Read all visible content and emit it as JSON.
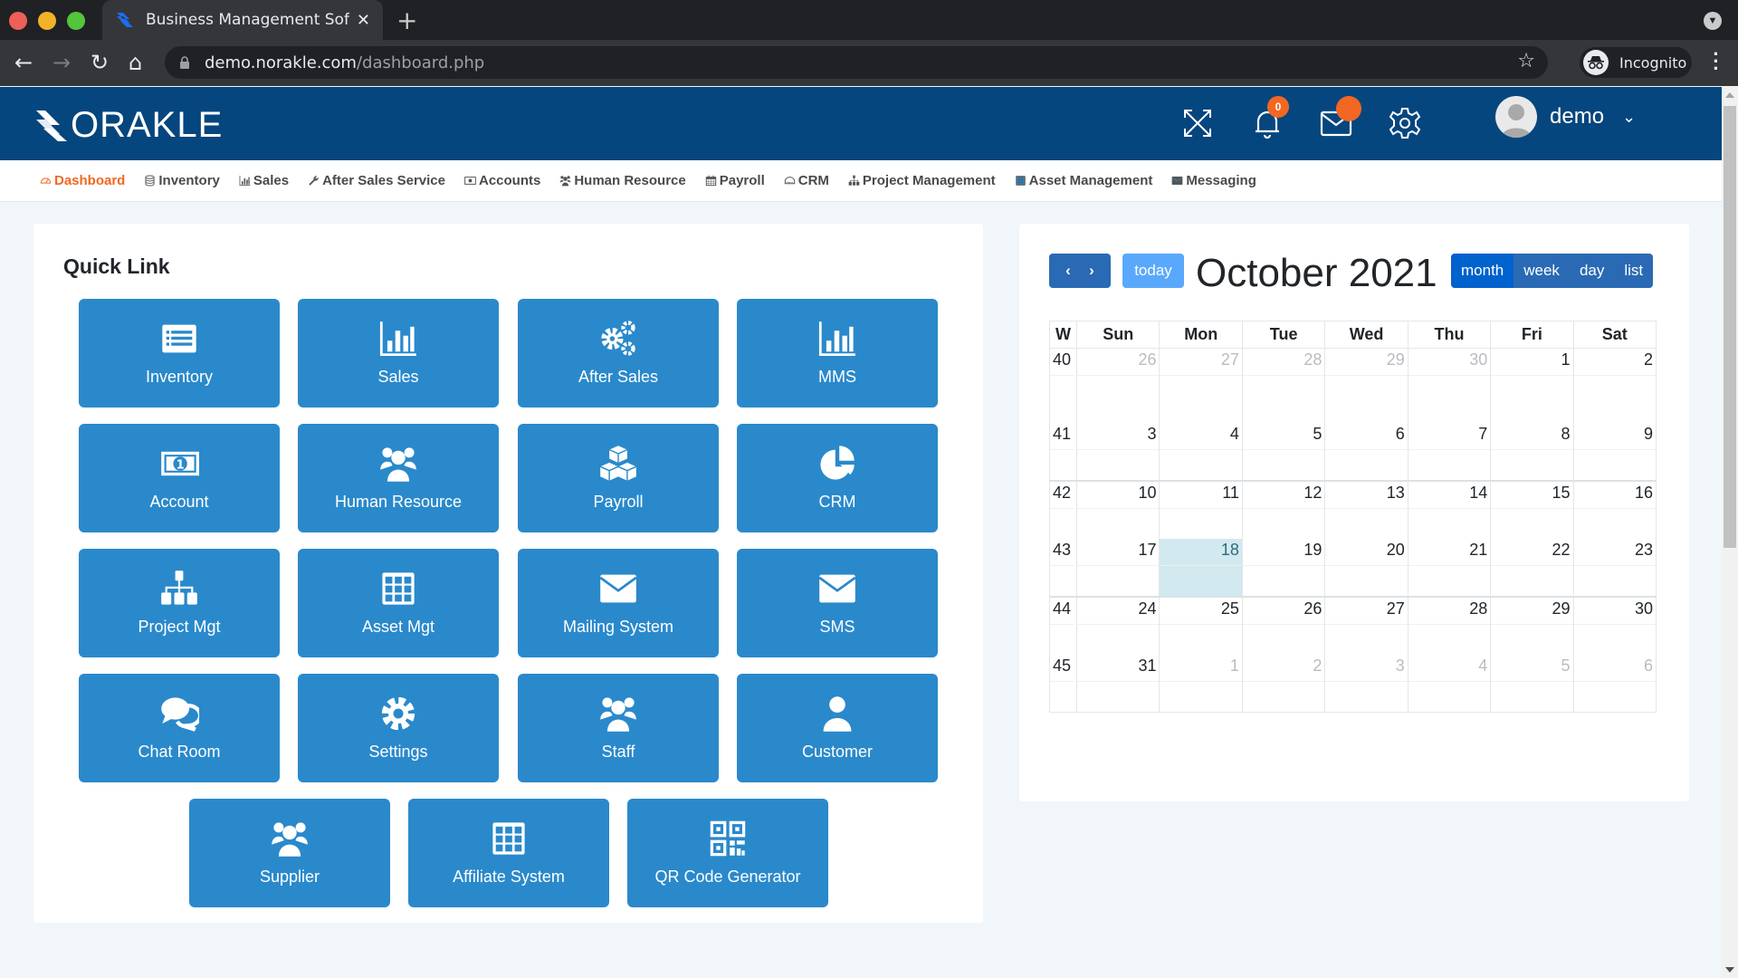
{
  "browser": {
    "tab_title": "Business Management Softw",
    "url_host": "demo.norakle.com",
    "url_path": "/dashboard.php",
    "profile_label": "Incognito"
  },
  "header": {
    "logo_text": "ORAKLE",
    "notification_count": "0",
    "username": "demo"
  },
  "nav": {
    "items": [
      {
        "label": "Dashboard",
        "icon": "dashboard-icon",
        "active": true
      },
      {
        "label": "Inventory",
        "icon": "database-icon"
      },
      {
        "label": "Sales",
        "icon": "bar-chart-icon"
      },
      {
        "label": "After Sales Service",
        "icon": "wrench-icon"
      },
      {
        "label": "Accounts",
        "icon": "money-icon"
      },
      {
        "label": "Human Resource",
        "icon": "users-icon"
      },
      {
        "label": "Payroll",
        "icon": "calendar-icon"
      },
      {
        "label": "CRM",
        "icon": "crm-icon"
      },
      {
        "label": "Project Management",
        "icon": "sitemap-icon"
      },
      {
        "label": "Asset Management",
        "icon": "table-icon"
      },
      {
        "label": "Messaging",
        "icon": "envelope-icon"
      }
    ]
  },
  "quick_link": {
    "title": "Quick Link",
    "tiles": [
      {
        "label": "Inventory",
        "icon": "list-alt-icon"
      },
      {
        "label": "Sales",
        "icon": "bar-chart-icon"
      },
      {
        "label": "After Sales",
        "icon": "cogs-icon"
      },
      {
        "label": "MMS",
        "icon": "bar-chart-icon"
      },
      {
        "label": "Account",
        "icon": "money-bill-icon"
      },
      {
        "label": "Human Resource",
        "icon": "users-icon"
      },
      {
        "label": "Payroll",
        "icon": "cubes-icon"
      },
      {
        "label": "CRM",
        "icon": "pie-chart-icon"
      },
      {
        "label": "Project Mgt",
        "icon": "sitemap-icon"
      },
      {
        "label": "Asset Mgt",
        "icon": "table-icon"
      },
      {
        "label": "Mailing System",
        "icon": "envelope-icon"
      },
      {
        "label": "SMS",
        "icon": "envelope-icon"
      },
      {
        "label": "Chat Room",
        "icon": "comments-icon"
      },
      {
        "label": "Settings",
        "icon": "gear-icon"
      },
      {
        "label": "Staff",
        "icon": "users-icon"
      },
      {
        "label": "Customer",
        "icon": "user-icon"
      },
      {
        "label": "Supplier",
        "icon": "users-icon"
      },
      {
        "label": "Affiliate System",
        "icon": "table-icon"
      },
      {
        "label": "QR Code Generator",
        "icon": "qrcode-icon"
      }
    ]
  },
  "calendar": {
    "title": "October 2021",
    "today_label": "today",
    "views": [
      "month",
      "week",
      "day",
      "list"
    ],
    "active_view": "month",
    "headers": [
      "W",
      "Sun",
      "Mon",
      "Tue",
      "Wed",
      "Thu",
      "Fri",
      "Sat"
    ],
    "today_date": "18",
    "weeks": [
      {
        "wk": "40",
        "days": [
          [
            "26",
            1
          ],
          [
            "27",
            1
          ],
          [
            "28",
            1
          ],
          [
            "29",
            1
          ],
          [
            "30",
            1
          ],
          [
            "1",
            0
          ],
          [
            "2",
            0
          ]
        ]
      },
      {
        "wk": "41",
        "days": [
          [
            "3",
            0
          ],
          [
            "4",
            0
          ],
          [
            "5",
            0
          ],
          [
            "6",
            0
          ],
          [
            "7",
            0
          ],
          [
            "8",
            0
          ],
          [
            "9",
            0
          ]
        ]
      },
      {
        "wk": "42",
        "days": [
          [
            "10",
            0
          ],
          [
            "11",
            0
          ],
          [
            "12",
            0
          ],
          [
            "13",
            0
          ],
          [
            "14",
            0
          ],
          [
            "15",
            0
          ],
          [
            "16",
            0
          ]
        ]
      },
      {
        "wk": "43",
        "days": [
          [
            "17",
            0
          ],
          [
            "18",
            2
          ],
          [
            "19",
            0
          ],
          [
            "20",
            0
          ],
          [
            "21",
            0
          ],
          [
            "22",
            0
          ],
          [
            "23",
            0
          ]
        ]
      },
      {
        "wk": "44",
        "days": [
          [
            "24",
            0
          ],
          [
            "25",
            0
          ],
          [
            "26",
            0
          ],
          [
            "27",
            0
          ],
          [
            "28",
            0
          ],
          [
            "29",
            0
          ],
          [
            "30",
            0
          ]
        ]
      },
      {
        "wk": "45",
        "days": [
          [
            "31",
            0
          ],
          [
            "1",
            1
          ],
          [
            "2",
            1
          ],
          [
            "3",
            1
          ],
          [
            "4",
            1
          ],
          [
            "5",
            1
          ],
          [
            "6",
            1
          ]
        ]
      }
    ]
  },
  "colors": {
    "header_bg": "#06467e",
    "tile_bg": "#2a89cb",
    "accent_orange": "#f26722",
    "today_cell": "#d2e9ef"
  }
}
